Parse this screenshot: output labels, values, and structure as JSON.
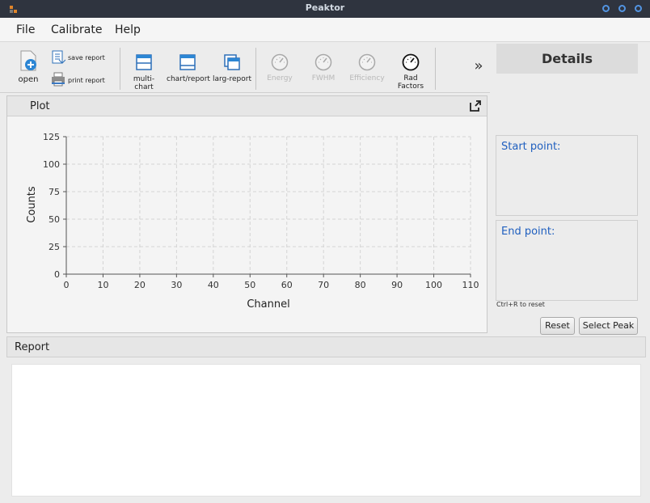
{
  "window": {
    "title": "Peaktor"
  },
  "menu": [
    "File",
    "Calibrate",
    "Help"
  ],
  "toolbar": {
    "open": "open",
    "save_report": "save report",
    "print_report": "print report",
    "multi_chart": "multi-chart",
    "chart_report": "chart/report",
    "larg_report": "larg-report",
    "energy": "Energy",
    "fwhm": "FWHM",
    "efficiency": "Efficiency",
    "rad_factors": "Rad Factors",
    "overflow": "»"
  },
  "plot": {
    "title": "Plot"
  },
  "details": {
    "title": "Details",
    "start_point": "Start point:",
    "end_point": "End point:",
    "hint": "Ctrl+R to reset",
    "reset_label": "Reset",
    "select_peak_label": "Select Peak"
  },
  "report": {
    "title": "Report"
  },
  "colors": {
    "titlebar": "#2f343f",
    "accent": "#5294e2",
    "label_blue": "#1f5fbf"
  },
  "chart_data": {
    "type": "line",
    "series": [],
    "xlabel": "Channel",
    "ylabel": "Counts",
    "xlim": [
      0,
      110
    ],
    "ylim": [
      0,
      125
    ],
    "xticks": [
      0,
      10,
      20,
      30,
      40,
      50,
      60,
      70,
      80,
      90,
      100,
      110
    ],
    "yticks": [
      0,
      25,
      50,
      75,
      100,
      125
    ],
    "grid": true
  }
}
